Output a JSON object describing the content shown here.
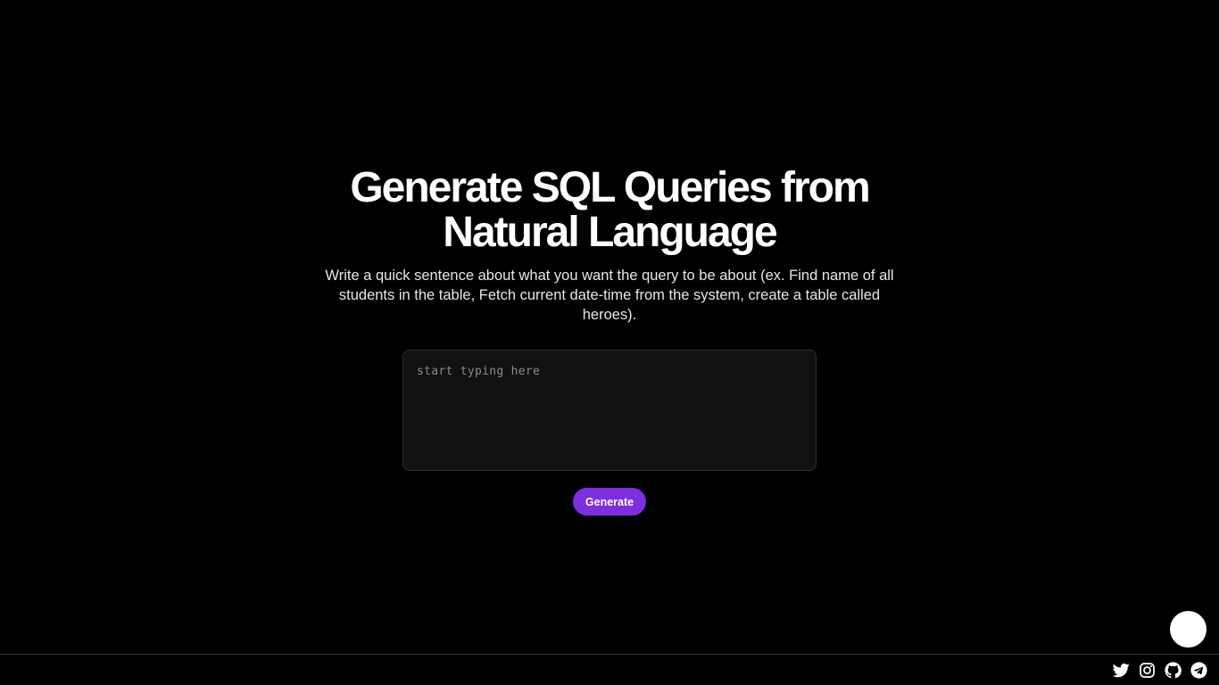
{
  "hero": {
    "title": "Generate SQL Queries from Natural Language",
    "subtitle": "Write a quick sentence about what you want the query to be about (ex. Find name of all students in the table, Fetch current date-time from the system, create a table called heroes)."
  },
  "query_input": {
    "placeholder": "start typing here",
    "value": ""
  },
  "generate_button": {
    "label": "Generate"
  },
  "footer": {
    "social_icons": [
      "twitter-icon",
      "instagram-icon",
      "github-icon",
      "telegram-icon"
    ]
  },
  "colors": {
    "background": "#000000",
    "accent": "#7c2ee0",
    "input_background": "#111111",
    "text": "#ffffff"
  }
}
